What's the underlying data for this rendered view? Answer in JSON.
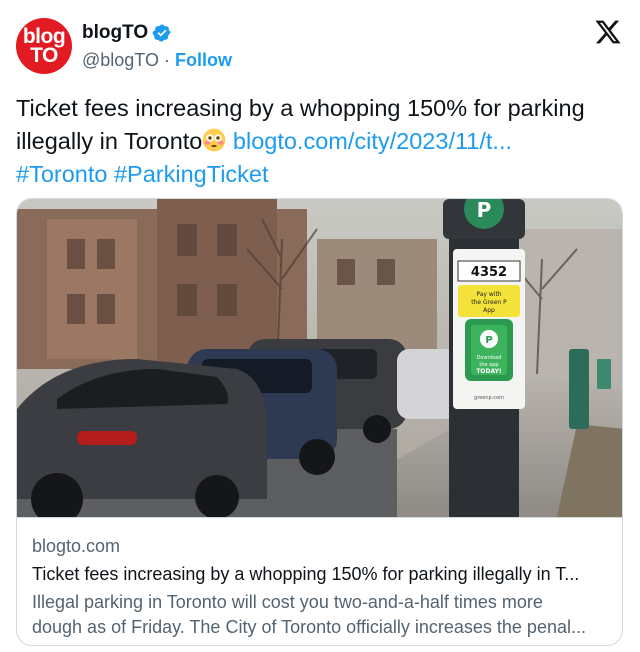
{
  "author": {
    "avatar_line1": "blog",
    "avatar_line2": "TO",
    "display_name": "blogTO",
    "handle": "@blogTO",
    "separator": "·",
    "follow_label": "Follow",
    "verified_icon": "verified-badge-icon",
    "brand_color": "#e21b23"
  },
  "platform_icon": "x-logo-icon",
  "tweet": {
    "text_part1": "Ticket fees increasing by a whopping 150% for parking illegally in Toronto",
    "emoji": "flushed-face-emoji",
    "link": "blogto.com/city/2023/11/t...",
    "hashtag1": "#Toronto",
    "hashtag2": "#ParkingTicket",
    "link_color": "#1d9bf0"
  },
  "preview": {
    "meter_number": "4352",
    "meter_sign": "Pay with the Green P App",
    "meter_download": "Download the app TODAY!",
    "domain": "blogto.com",
    "headline": "Ticket fees increasing by a whopping 150% for parking illegally in T...",
    "description_line1": "Illegal parking in Toronto will cost you two-and-a-half times more",
    "description_line2": "dough as of Friday. The City of Toronto officially increases the penal..."
  }
}
